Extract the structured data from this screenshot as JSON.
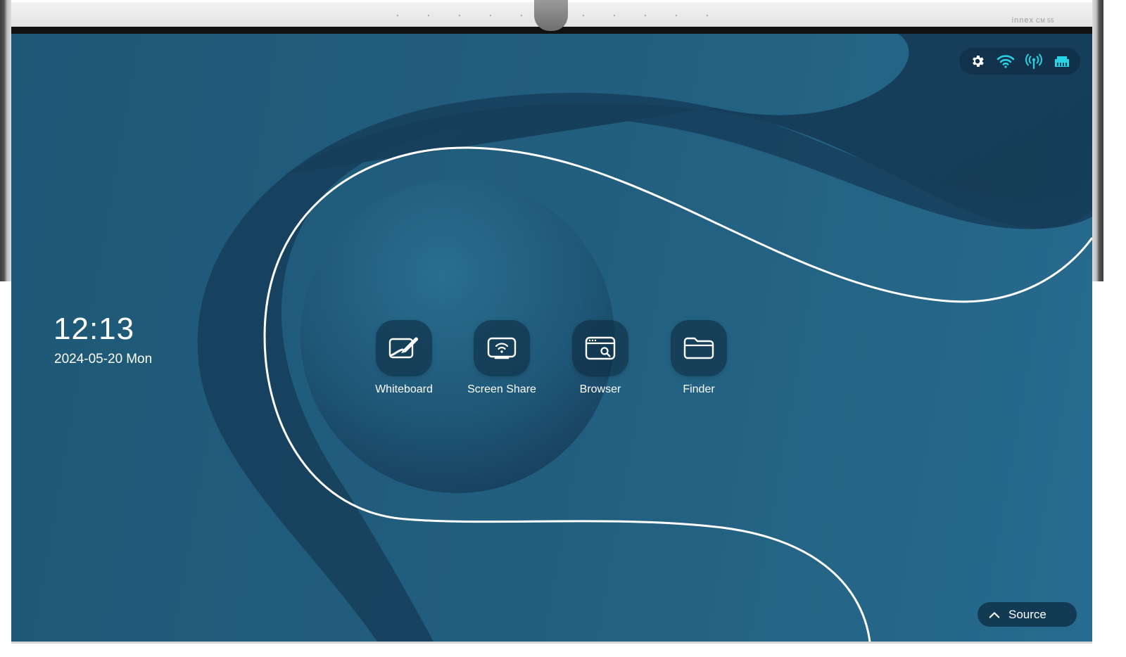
{
  "device": {
    "brand": "innex",
    "model": "CM 55",
    "camera_label": "innex"
  },
  "status_bar": {
    "icons": [
      "gear-icon",
      "wifi-icon",
      "hotspot-icon",
      "ethernet-icon"
    ],
    "icon_color": "#29d3e6"
  },
  "clock": {
    "time": "12:13",
    "date": "2024-05-20",
    "weekday": "Mon"
  },
  "apps": [
    {
      "label": "Whiteboard",
      "icon": "whiteboard-icon"
    },
    {
      "label": "Screen Share",
      "icon": "screen-share-icon"
    },
    {
      "label": "Browser",
      "icon": "browser-icon"
    },
    {
      "label": "Finder",
      "icon": "folder-icon"
    }
  ],
  "source_button": {
    "label": "Source",
    "icon": "chevron-up-icon"
  },
  "colors": {
    "background": "#225e7e",
    "accent": "#29d3e6",
    "text": "#ffffff"
  }
}
